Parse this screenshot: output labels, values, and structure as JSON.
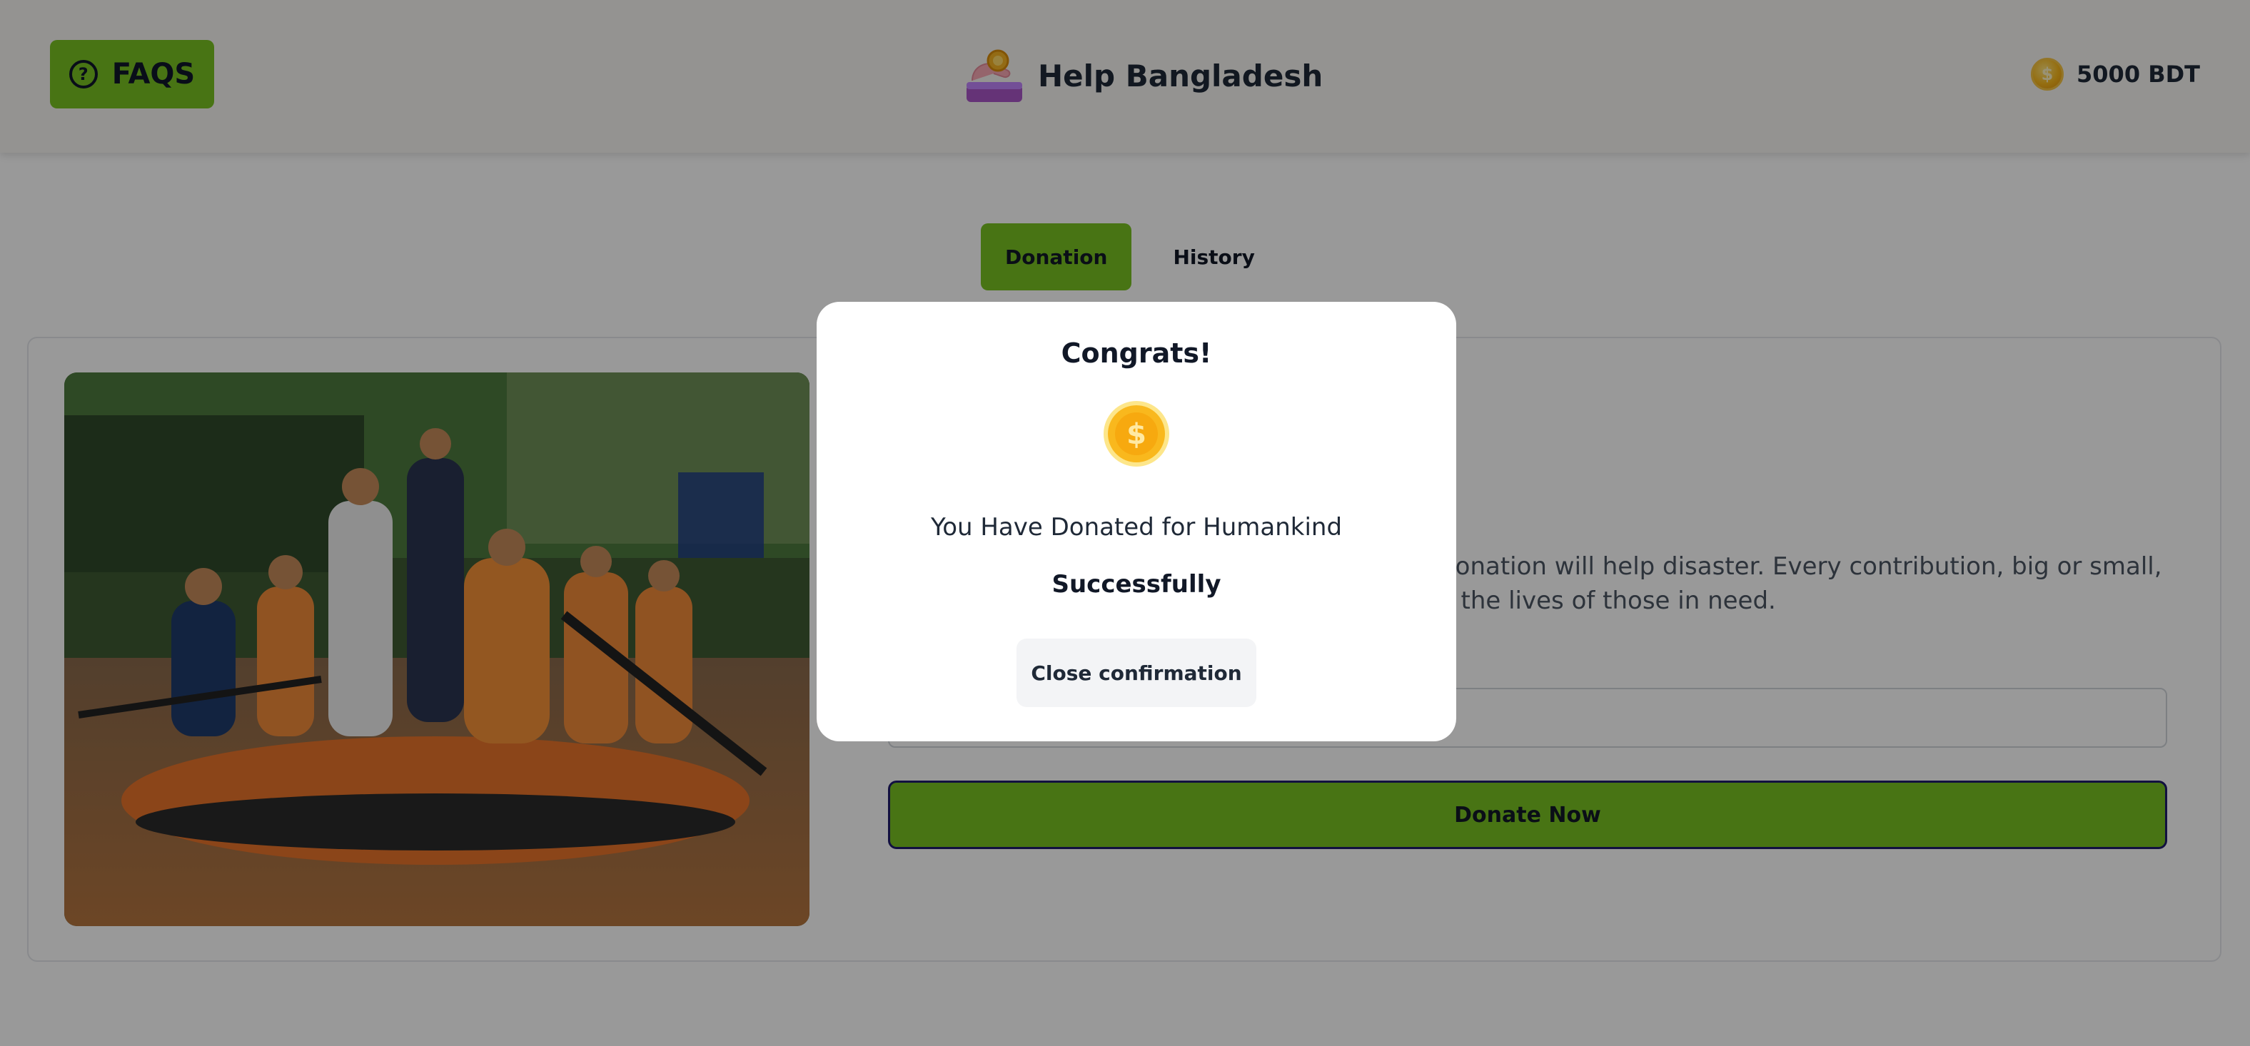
{
  "header": {
    "faq_label": "FAQS",
    "brand_title": "Help Bangladesh",
    "balance": "5000 BDT"
  },
  "tabs": [
    {
      "label": "Donation",
      "active": true
    },
    {
      "label": "History",
      "active": false
    }
  ],
  "campaign": {
    "description_visible": "nt damage to homes and infrastructure. Your donation will help disaster. Every contribution, big or small, makes a difference. aking a positive impact on the lives of those in need.",
    "donate_label": "Donate Now"
  },
  "modal": {
    "title": "Congrats!",
    "message": "You Have Donated for Humankind",
    "status": "Successfully",
    "close_label": "Close confirmation"
  },
  "colors": {
    "accent": "#79c222",
    "donate_border": "#1e1b6b",
    "coin": "#f8b81c"
  },
  "icons": {
    "faq": "question-circle-icon",
    "brand": "donation-hand-icon",
    "balance": "coin-icon",
    "modal": "coin-icon"
  }
}
